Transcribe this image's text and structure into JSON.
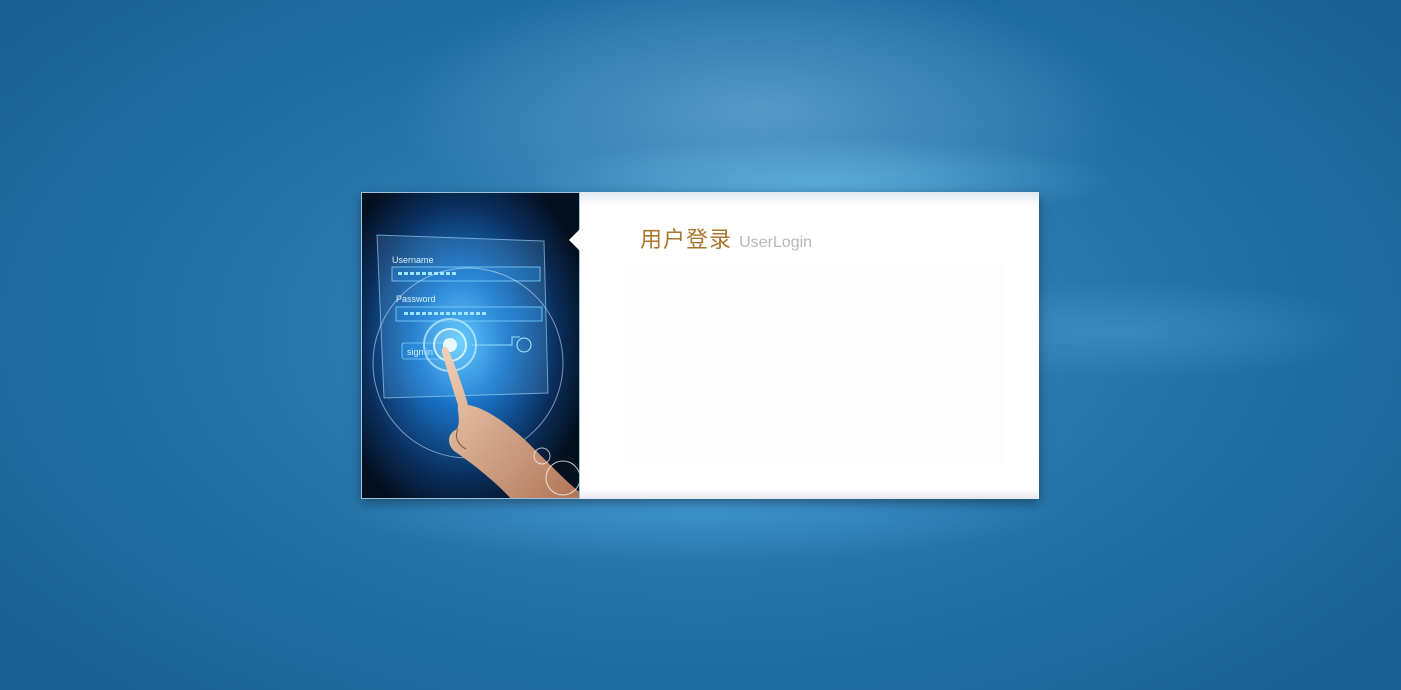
{
  "login": {
    "title_cn": "用户登录",
    "title_en": "UserLogin"
  },
  "hero_image": {
    "username_label": "Username",
    "password_label": "Password",
    "signin_label": "sign in"
  },
  "colors": {
    "background": "#2470a3",
    "card": "#ffffff",
    "title_cn": "#a8762b",
    "title_en": "#b8b8b8"
  }
}
